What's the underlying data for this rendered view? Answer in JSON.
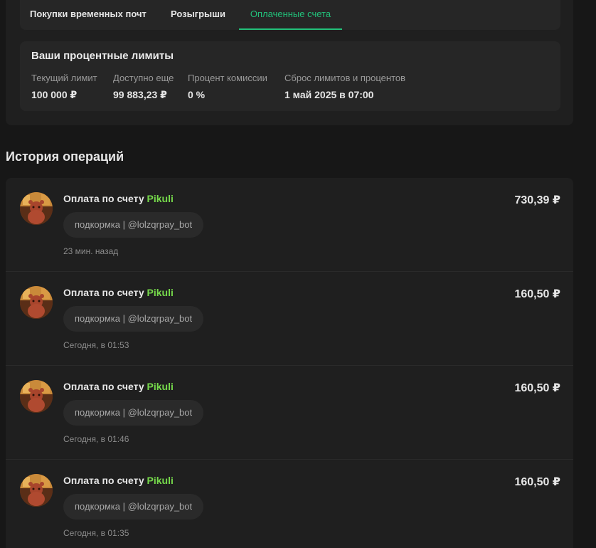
{
  "tabs": [
    {
      "label": "Покупки временных почт"
    },
    {
      "label": "Розыгрыши"
    },
    {
      "label": "Оплаченные счета",
      "active": true
    }
  ],
  "limits": {
    "title": "Ваши процентные лимиты",
    "columns": [
      {
        "label": "Текущий лимит",
        "value": "100 000 ₽"
      },
      {
        "label": "Доступно еще",
        "value": "99 883,23 ₽"
      },
      {
        "label": "Процент комиссии",
        "value": "0 %"
      },
      {
        "label": "Сброс лимитов и процентов",
        "value": "1 май 2025 в 07:00"
      }
    ]
  },
  "history": {
    "title": "История операций",
    "operations": [
      {
        "prefix": "Оплата по счету",
        "user": "Pikuli",
        "comment": "подкормка | @lolzqrpay_bot",
        "time": "23 мин. назад",
        "amount": "730,39 ₽"
      },
      {
        "prefix": "Оплата по счету",
        "user": "Pikuli",
        "comment": "подкормка | @lolzqrpay_bot",
        "time": "Сегодня, в 01:53",
        "amount": "160,50 ₽"
      },
      {
        "prefix": "Оплата по счету",
        "user": "Pikuli",
        "comment": "подкормка | @lolzqrpay_bot",
        "time": "Сегодня, в 01:46",
        "amount": "160,50 ₽"
      },
      {
        "prefix": "Оплата по счету",
        "user": "Pikuli",
        "comment": "подкормка | @lolzqrpay_bot",
        "time": "Сегодня, в 01:35",
        "amount": "160,50 ₽"
      }
    ]
  },
  "colors": {
    "accent": "#22c07a",
    "username": "#76d94b"
  }
}
